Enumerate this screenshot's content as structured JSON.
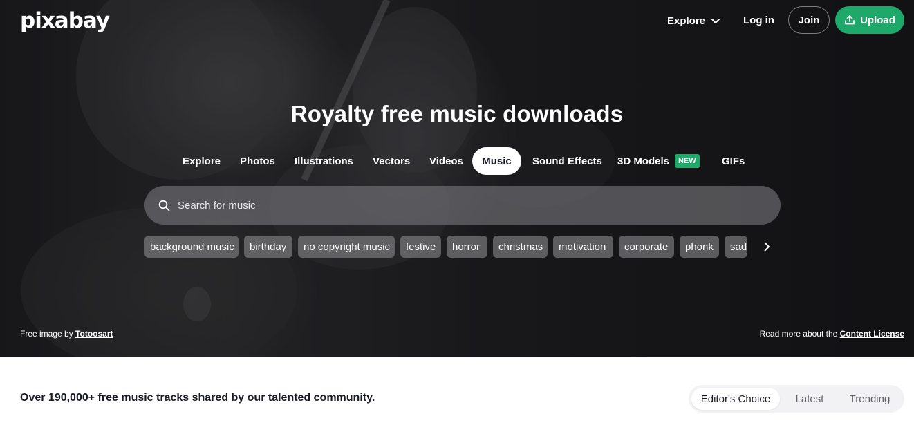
{
  "brand": {
    "logo_text": "pixabay"
  },
  "header": {
    "explore_label": "Explore",
    "login_label": "Log in",
    "join_label": "Join",
    "upload_label": "Upload"
  },
  "hero": {
    "title": "Royalty free music downloads",
    "tabs": [
      {
        "label": "Explore"
      },
      {
        "label": "Photos"
      },
      {
        "label": "Illustrations"
      },
      {
        "label": "Vectors"
      },
      {
        "label": "Videos"
      },
      {
        "label": "Music",
        "active": true
      },
      {
        "label": "Sound Effects"
      },
      {
        "label": "3D Models",
        "badge": "NEW"
      },
      {
        "label": "GIFs"
      }
    ],
    "search": {
      "placeholder": "Search for music",
      "value": ""
    },
    "chips": [
      "background music",
      "birthday",
      "no copyright music",
      "festive",
      "horror",
      "christmas",
      "motivation",
      "corporate",
      "phonk",
      "sad"
    ],
    "credit_left_prefix": "Free image by ",
    "credit_left_author": "Totoosart",
    "credit_right_prefix": "Read more about the ",
    "credit_right_link": "Content License"
  },
  "main": {
    "tagline": "Over 190,000+ free music tracks shared by our talented community.",
    "sort_options": [
      {
        "label": "Editor's Choice",
        "active": true
      },
      {
        "label": "Latest"
      },
      {
        "label": "Trending"
      }
    ]
  },
  "colors": {
    "accent": "#1ea86a",
    "text_dark": "#191b26"
  }
}
